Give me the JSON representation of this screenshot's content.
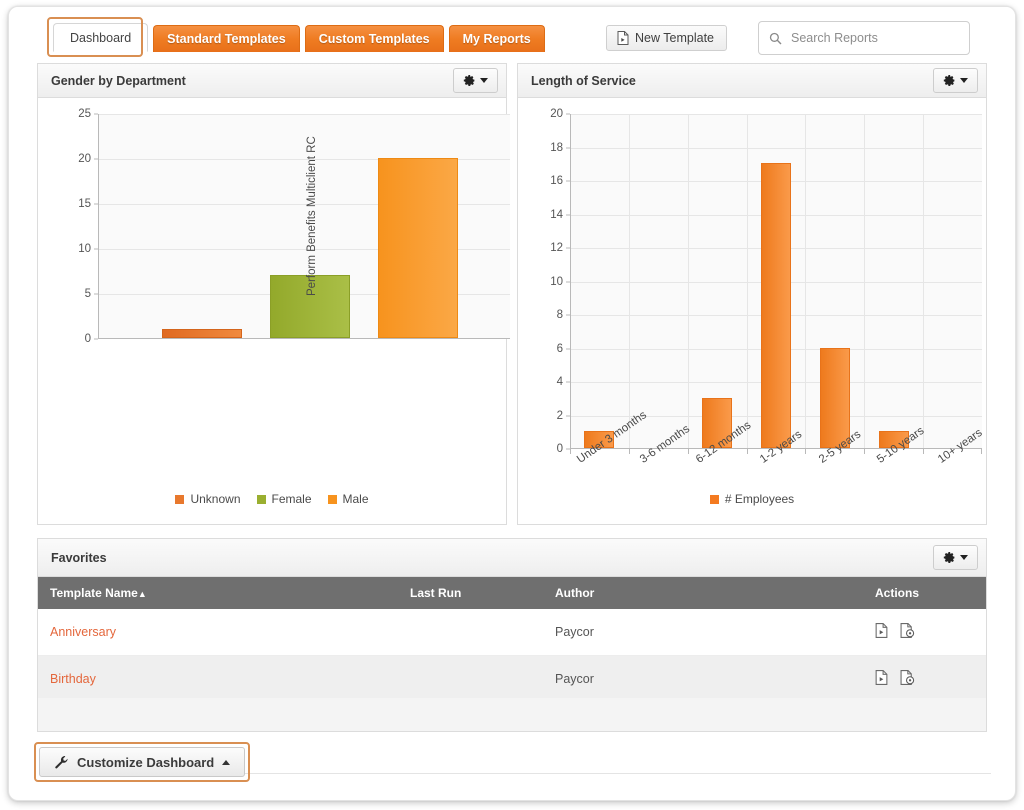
{
  "header": {
    "tabs": [
      {
        "label": "Dashboard",
        "active": true,
        "name": "tab-dashboard"
      },
      {
        "label": "Standard Templates",
        "active": false,
        "name": "tab-standard-templates"
      },
      {
        "label": "Custom Templates",
        "active": false,
        "name": "tab-custom-templates"
      },
      {
        "label": "My Reports",
        "active": false,
        "name": "tab-my-reports"
      }
    ],
    "new_template_label": "New Template",
    "new_template_icon": "new-document-icon",
    "search": {
      "placeholder": "Search Reports",
      "value": "",
      "icon": "search-icon"
    }
  },
  "panels": {
    "gender": {
      "title": "Gender by Department",
      "gear_icon": "gear-icon",
      "caret_icon": "chevron-down-icon"
    },
    "service": {
      "title": "Length of Service",
      "gear_icon": "gear-icon",
      "caret_icon": "chevron-down-icon"
    },
    "favorites": {
      "title": "Favorites",
      "gear_icon": "gear-icon",
      "caret_icon": "chevron-down-icon"
    }
  },
  "chart_data": [
    {
      "id": "gender-by-department",
      "type": "bar",
      "title": "Gender by Department",
      "categories": [
        "Perform Benefits Multiclient RC"
      ],
      "series": [
        {
          "name": "Unknown",
          "values": [
            1
          ],
          "color": "#e8782d"
        },
        {
          "name": "Female",
          "values": [
            7
          ],
          "color": "#9aaf30"
        },
        {
          "name": "Male",
          "values": [
            20
          ],
          "color": "#f7931e"
        }
      ],
      "xlabel": "",
      "ylabel": "",
      "ylim": [
        0,
        25
      ],
      "yticks": [
        0,
        5,
        10,
        15,
        20,
        25
      ],
      "xtick_labels": [
        "Perform Benefits Multiclient RC"
      ],
      "xtick_rotation": -90,
      "grid": true,
      "legend_position": "bottom",
      "legend": [
        "Unknown",
        "Female",
        "Male"
      ]
    },
    {
      "id": "length-of-service",
      "type": "bar",
      "title": "Length of Service",
      "categories": [
        "Under 3 months",
        "3-6 months",
        "6-12 months",
        "1-2 years",
        "2-5 years",
        "5-10 years",
        "10+ years"
      ],
      "series": [
        {
          "name": "# Employees",
          "values": [
            1,
            0,
            3,
            17,
            6,
            1,
            0
          ],
          "color": "#f47a20"
        }
      ],
      "xlabel": "",
      "ylabel": "",
      "ylim": [
        0,
        20
      ],
      "yticks": [
        0,
        2,
        4,
        6,
        8,
        10,
        12,
        14,
        16,
        18,
        20
      ],
      "xtick_labels": [
        "Under 3 months",
        "3-6 months",
        "6-12 months",
        "1-2 years",
        "2-5 years",
        "5-10 years",
        "10+ years"
      ],
      "xtick_rotation": -35,
      "grid": true,
      "legend_position": "bottom",
      "legend": [
        "# Employees"
      ]
    }
  ],
  "favorites_table": {
    "columns": [
      {
        "label": "Template Name",
        "sort_indicator": "▲",
        "key": "template_name"
      },
      {
        "label": "Last Run",
        "sort_indicator": "",
        "key": "last_run"
      },
      {
        "label": "Author",
        "sort_indicator": "",
        "key": "author"
      },
      {
        "label": "Actions",
        "sort_indicator": "",
        "key": "actions"
      }
    ],
    "rows": [
      {
        "template_name": "Anniversary",
        "last_run": "",
        "author": "Paycor",
        "actions": [
          "run-report-icon",
          "schedule-report-icon"
        ]
      },
      {
        "template_name": "Birthday",
        "last_run": "",
        "author": "Paycor",
        "actions": [
          "run-report-icon",
          "schedule-report-icon"
        ]
      }
    ]
  },
  "footer": {
    "customize_label": "Customize Dashboard",
    "customize_icon": "wrench-icon",
    "customize_caret": "chevron-up-icon"
  },
  "colors": {
    "brand_orange": "#ef7c22",
    "link_orange": "#e4673c",
    "bar_unknown": "#e8782d",
    "bar_female": "#9aaf30",
    "bar_male": "#f7931e",
    "bar_employees": "#f47a20",
    "table_header": "#6f6f6f",
    "highlight_border": "#d98f52"
  }
}
